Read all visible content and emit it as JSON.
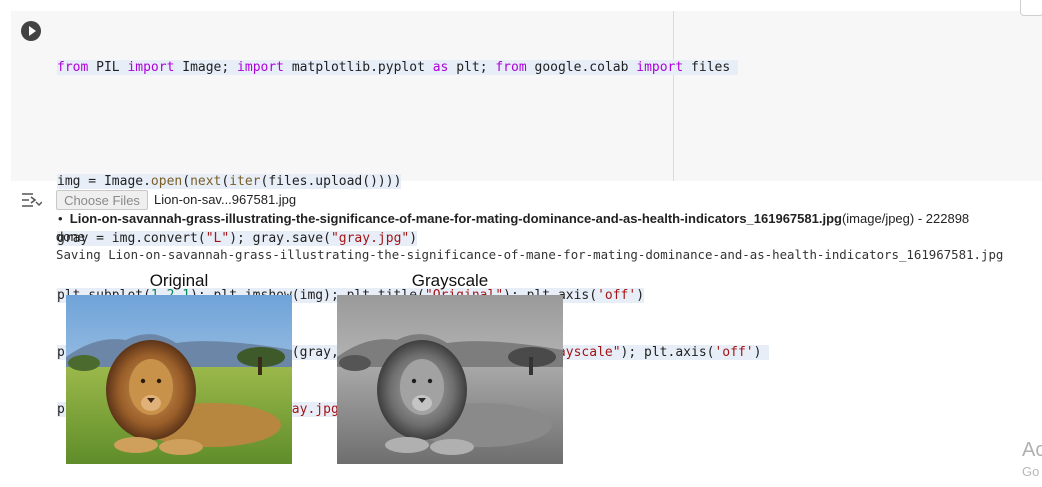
{
  "code_lines": [
    "from PIL import Image; import matplotlib.pyplot as plt; from google.colab import files",
    "",
    "img = Image.open(next(iter(files.upload())))",
    "gray = img.convert(\"L\"); gray.save(\"gray.jpg\")",
    "plt.subplot(1,2,1); plt.imshow(img); plt.title(\"Original\"); plt.axis('off')",
    "plt.subplot(1,2,2); plt.imshow(gray, cmap='gray'); plt.title(\"Grayscale\"); plt.axis('off')",
    "plt.show(); files.download(\"gray.jpg\")"
  ],
  "output": {
    "choose_files_label": "Choose Files",
    "chosen_file": "Lion-on-sav...967581.jpg",
    "bullet_filename": "Lion-on-savannah-grass-illustrating-the-significance-of-mane-for-mating-dominance-and-as-health-indicators_161967581.jpg",
    "bullet_meta": "(image/jpeg) - 222898",
    "done": "done",
    "saving": "Saving Lion-on-savannah-grass-illustrating-the-significance-of-mane-for-mating-dominance-and-as-health-indicators_161967581.jpg"
  },
  "plots": {
    "left_title": "Original",
    "right_title": "Grayscale"
  },
  "watermark": {
    "line1": "Ac",
    "line2": "Go"
  },
  "icons": {
    "run": "play-circle-icon",
    "output_menu": "output-actions-icon"
  }
}
